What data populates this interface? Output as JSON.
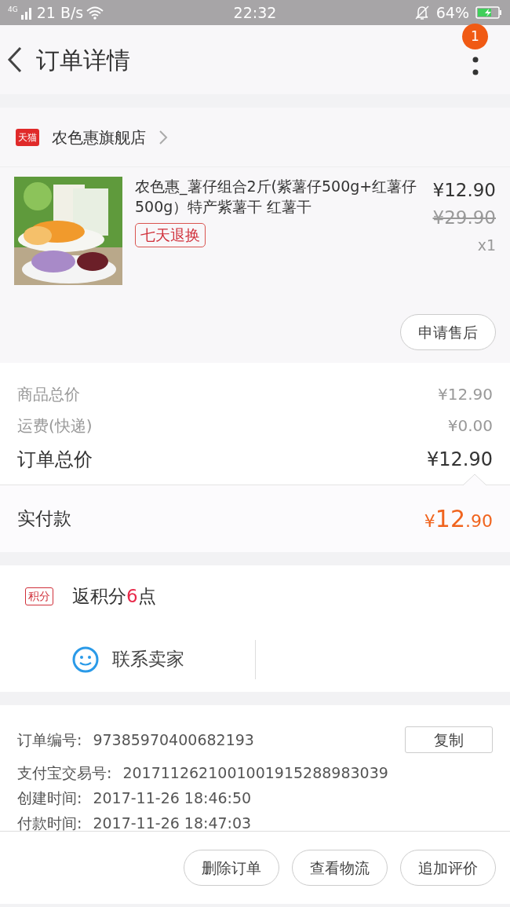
{
  "status_bar": {
    "network": "4G",
    "speed": "21 B/s",
    "time": "22:32",
    "battery": "64%"
  },
  "header": {
    "title": "订单详情",
    "badge": "1"
  },
  "shop": {
    "tag": "天猫",
    "name": "农色惠旗舰店"
  },
  "product": {
    "title": "农色惠_薯仔组合2斤(紫薯仔500g+红薯仔500g）特产紫薯干 红薯干",
    "tag": "七天退换",
    "price": "¥12.90",
    "original_price": "¥29.90",
    "quantity": "x1",
    "action": "申请售后"
  },
  "summary": [
    {
      "label": "商品总价",
      "value": "¥12.90",
      "kind": "minor"
    },
    {
      "label": "运费(快递)",
      "value": "¥0.00",
      "kind": "minor"
    },
    {
      "label": "订单总价",
      "value": "¥12.90",
      "kind": "major"
    }
  ],
  "payment": {
    "label": "实付款",
    "currency": "¥",
    "integer": "12",
    "fraction": ".90"
  },
  "points": {
    "tag": "积分",
    "prefix": "返积分",
    "count": "6",
    "suffix": "点"
  },
  "contact": {
    "label": "联系卖家"
  },
  "details": [
    {
      "label": "订单编号:",
      "value": "97385970400682193",
      "copy": "复制"
    },
    {
      "label": "支付宝交易号:",
      "value": "2017112621001001915288983039"
    },
    {
      "label": "创建时间:",
      "value": "2017-11-26 18:46:50"
    },
    {
      "label": "付款时间:",
      "value": "2017-11-26 18:47:03"
    }
  ],
  "actions": [
    "删除订单",
    "查看物流",
    "追加评价"
  ]
}
